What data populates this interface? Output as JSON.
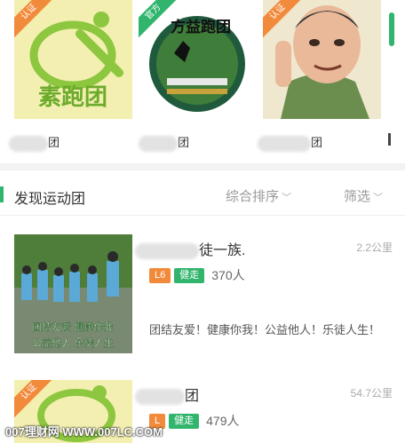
{
  "carousel": {
    "cards": [
      {
        "badge": "认证",
        "logo_text": "素跑团",
        "caption_suffix": "团"
      },
      {
        "badge": "官方",
        "logo_text": "方益跑团",
        "caption_suffix": "团"
      },
      {
        "badge": "认证",
        "caption_suffix": "团"
      }
    ]
  },
  "discover": {
    "title": "发现运动团",
    "sort_label": "综合排序",
    "filter_label": "筛选"
  },
  "list": [
    {
      "name_suffix": "徒一族.",
      "distance": "2.2公里",
      "level": "L6",
      "kind": "健走",
      "members": "370人",
      "photo_text_1": "团结友爱  健康你我",
      "photo_text_2": "公益他人  乐徒人生",
      "description": "团结友爱！健康你我！公益他人！乐徒人生！"
    },
    {
      "name_suffix": "团",
      "distance": "54.7公里",
      "level": "L",
      "kind": "健走",
      "members": "479人"
    }
  ],
  "watermark": "007理财网  WWW.007LC.COM",
  "colors": {
    "accent_green": "#31b56c",
    "level_orange": "#f28a3c"
  }
}
